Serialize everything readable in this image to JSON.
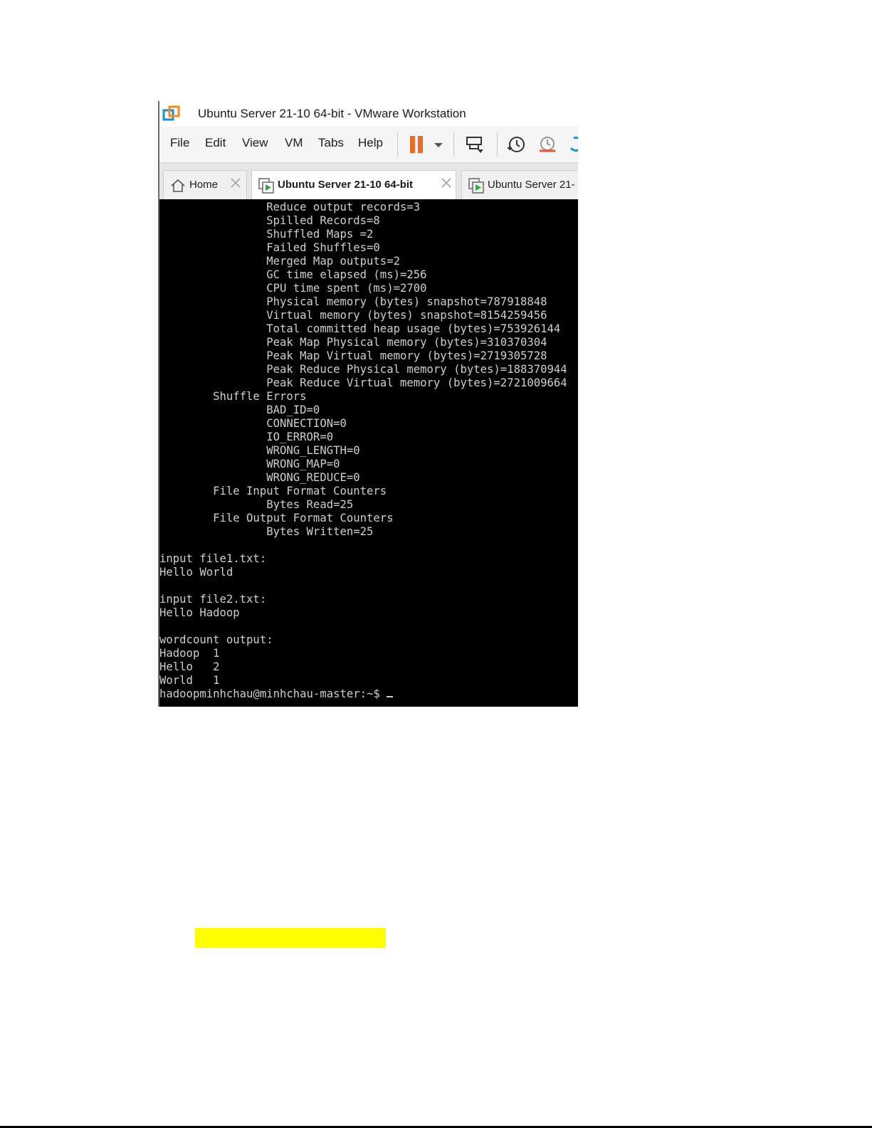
{
  "window": {
    "title": "Ubuntu Server 21-10 64-bit - VMware Workstation"
  },
  "menu": [
    "File",
    "Edit",
    "View",
    "VM",
    "Tabs",
    "Help"
  ],
  "toolbar_icons": [
    "pause-icon",
    "dropdown-arrow-icon",
    "send-keys-icon",
    "snapshot-icon",
    "revert-snapshot-icon",
    "snapshot-manager-icon"
  ],
  "tabs": [
    {
      "label": "Home",
      "active": false,
      "icon": "home-icon"
    },
    {
      "label": "Ubuntu Server 21-10 64-bit",
      "active": true,
      "icon": "vm-icon"
    },
    {
      "label": "Ubuntu Server 21-",
      "active": false,
      "icon": "vm-icon"
    }
  ],
  "console": {
    "lines": [
      "                Reduce output records=3",
      "                Spilled Records=8",
      "                Shuffled Maps =2",
      "                Failed Shuffles=0",
      "                Merged Map outputs=2",
      "                GC time elapsed (ms)=256",
      "                CPU time spent (ms)=2700",
      "                Physical memory (bytes) snapshot=787918848",
      "                Virtual memory (bytes) snapshot=8154259456",
      "                Total committed heap usage (bytes)=753926144",
      "                Peak Map Physical memory (bytes)=310370304",
      "                Peak Map Virtual memory (bytes)=2719305728",
      "                Peak Reduce Physical memory (bytes)=188370944",
      "                Peak Reduce Virtual memory (bytes)=2721009664",
      "        Shuffle Errors",
      "                BAD_ID=0",
      "                CONNECTION=0",
      "                IO_ERROR=0",
      "                WRONG_LENGTH=0",
      "                WRONG_MAP=0",
      "                WRONG_REDUCE=0",
      "        File Input Format Counters",
      "                Bytes Read=25",
      "        File Output Format Counters",
      "                Bytes Written=25",
      "",
      "input file1.txt:",
      "Hello World",
      "",
      "input file2.txt:",
      "Hello Hadoop",
      "",
      "wordcount output:",
      "Hadoop  1",
      "Hello   2",
      "World   1"
    ],
    "prompt": "hadoopminhchau@minhchau-master:~$ "
  },
  "colors": {
    "console_bg": "#000000",
    "console_fg": "#cfcfcf",
    "pause_orange": "#ec6a28",
    "highlight": "#ffff00"
  }
}
